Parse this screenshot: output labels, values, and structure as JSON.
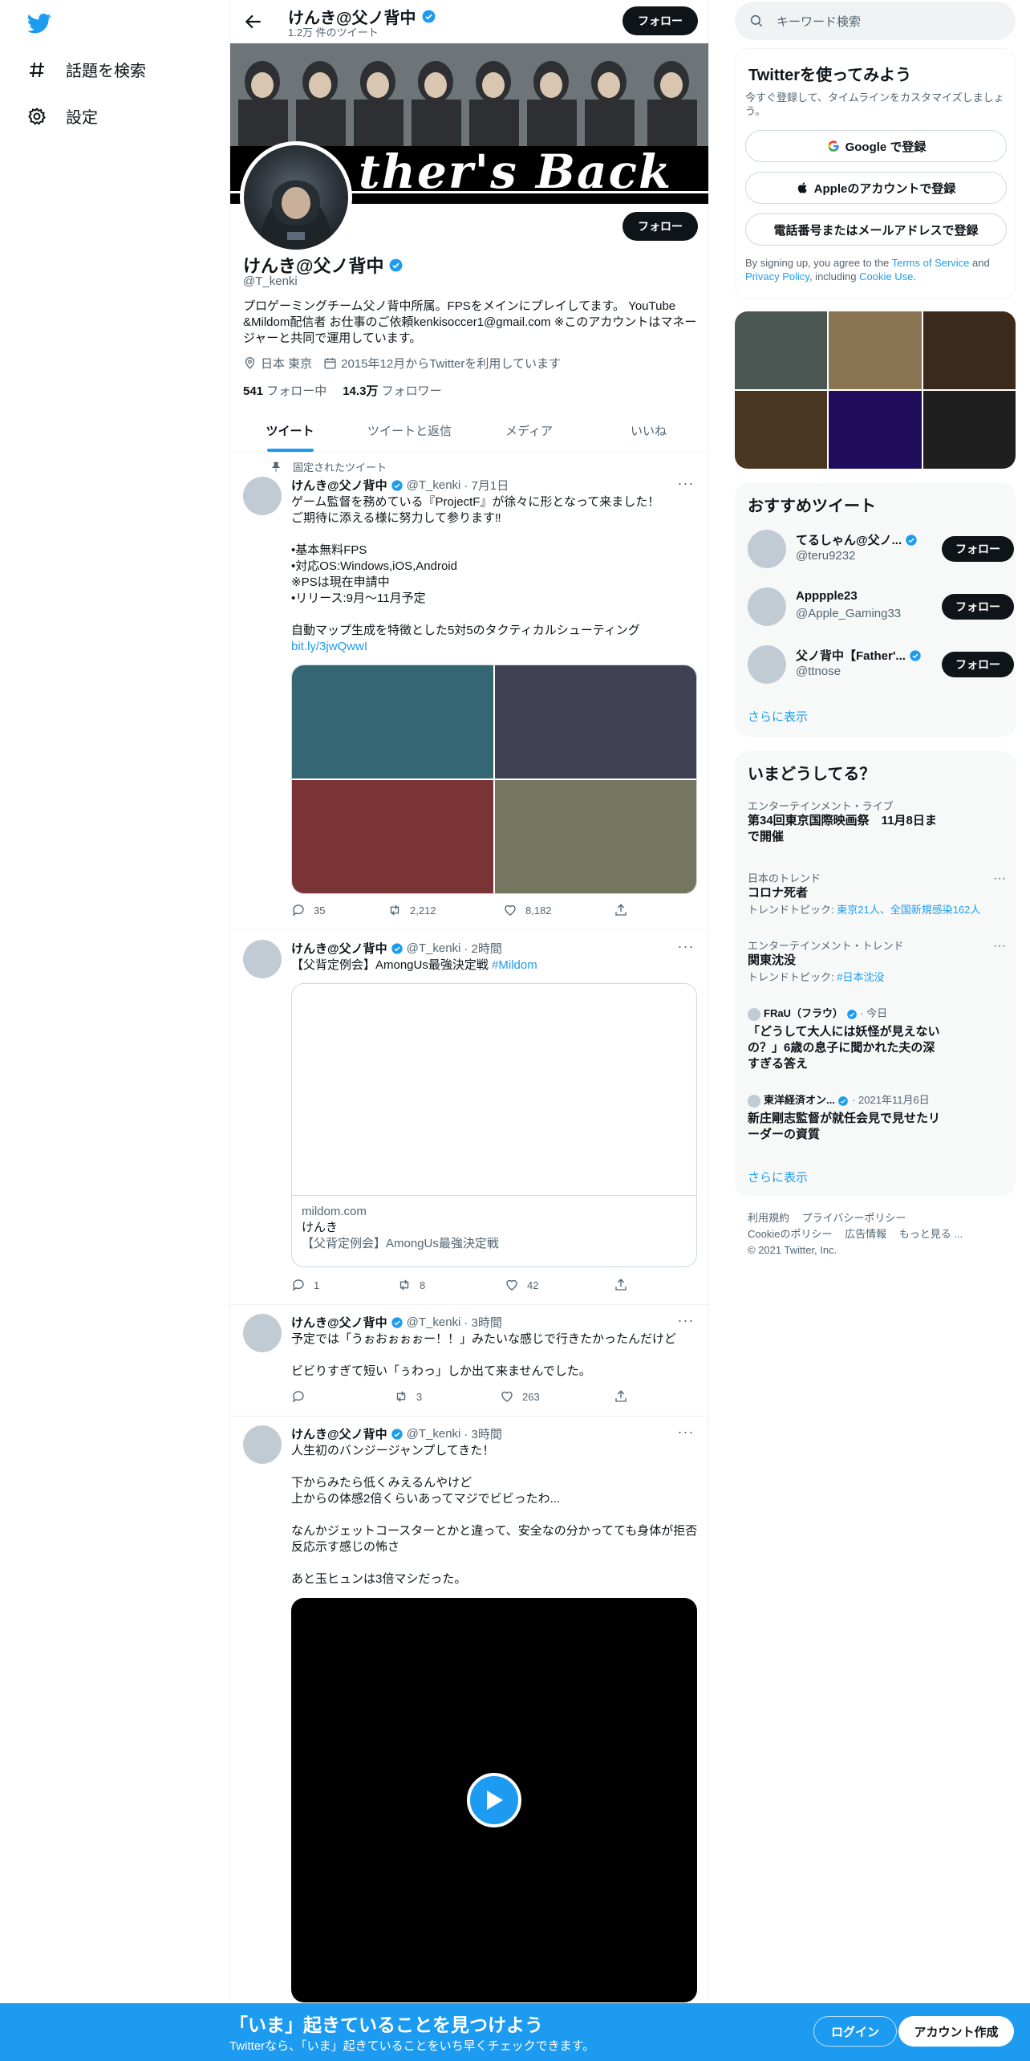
{
  "nav": {
    "explore_label": "話題を検索",
    "settings_label": "設定"
  },
  "header": {
    "name": "けんき@父ノ背中",
    "tweet_count": "1.2万 件のツイート",
    "follow_label": "フォロー"
  },
  "banner": {
    "text": "ther's Back"
  },
  "profile": {
    "name": "けんき@父ノ背中",
    "handle": "@T_kenki",
    "bio": "プロゲーミングチーム父ノ背中所属。FPSをメインにプレイしてます。 YouTube &Mildom配信者 お仕事のご依頼kenkisoccer1@gmail.com ※このアカウントはマネージャーと共同で運用しています。",
    "location": "日本 東京",
    "joined": "2015年12月からTwitterを利用しています",
    "following_count": "541",
    "following_label": "フォロー中",
    "followers_count": "14.3万",
    "followers_label": "フォロワー",
    "follow_label": "フォロー"
  },
  "tabs": [
    "ツイート",
    "ツイートと返信",
    "メディア",
    "いいね"
  ],
  "pinned_label": "固定されたツイート",
  "tweets": [
    {
      "name": "けんき@父ノ背中",
      "handle": "@T_kenki",
      "time": "· 7月1日",
      "text": "ゲーム監督を務めている『ProjectF』が徐々に形となって来ました！\nご期待に添える様に努力して参ります‼︎\n\n•基本無料FPS\n•対応OS:Windows,iOS,Android\n※PSは現在申請中\n•リリース:9月〜11月予定\n\n自動マップ生成を特徴とした5対5のタクティカルシューティング",
      "link": "bit.ly/3jwQwwI",
      "media_colors": [
        "#356674",
        "#3f4152",
        "#7b3436",
        "#74765f"
      ],
      "replies": "35",
      "retweets": "2,212",
      "likes": "8,182"
    },
    {
      "name": "けんき@父ノ背中",
      "handle": "@T_kenki",
      "time": "· 2時間",
      "text": "【父背定例会】AmongUs最強決定戦 ",
      "hashtag": "#Mildom",
      "card_domain": "mildom.com",
      "card_title": "けんき",
      "card_desc": "【父背定例会】AmongUs最強決定戦",
      "replies": "1",
      "retweets": "8",
      "likes": "42"
    },
    {
      "name": "けんき@父ノ背中",
      "handle": "@T_kenki",
      "time": "· 3時間",
      "text": "予定では「うぉおぉぉぉー！！」みたいな感じで行きたかったんだけど\n\nビビりすぎて短い「ぅわっ」しか出て来ませんでした。",
      "replies": "",
      "retweets": "3",
      "likes": "263"
    },
    {
      "name": "けんき@父ノ背中",
      "handle": "@T_kenki",
      "time": "· 3時間",
      "text": "人生初のバンジージャンプしてきた！\n\n下からみたら低くみえるんやけど\n上からの体感2倍くらいあってマジでビビったわ...\n\nなんかジェットコースターとかと違って、安全なの分かってても身体が拒否反応示す感じの怖さ\n\nあと玉ヒュンは3倍マシだった。"
    }
  ],
  "search": {
    "placeholder": "キーワード検索"
  },
  "signup_panel": {
    "title": "Twitterを使ってみよう",
    "subtitle": "今すぐ登録して、タイムラインをカスタマイズしましょう。",
    "google_label": "Google で登録",
    "apple_label": "Appleのアカウントで登録",
    "phone_label": "電話番号またはメールアドレスで登録",
    "legal_prefix": "By signing up, you agree to the ",
    "terms": "Terms of Service",
    "and": " and ",
    "privacy": "Privacy Policy",
    "including": ", including ",
    "cookie": "Cookie Use",
    "period": "."
  },
  "photo_grid_colors": [
    "#4a5651",
    "#8a7553",
    "#3b2a1c",
    "#4a3722",
    "#1f0d5c",
    "#1f1f1f"
  ],
  "recommended": {
    "title": "おすすめツイート",
    "users": [
      {
        "name": "てるしゃん@父ノ...",
        "handle": "@teru9232",
        "follow": "フォロー"
      },
      {
        "name": "Apppple23",
        "handle": "@Apple_Gaming33",
        "follow": "フォロー"
      },
      {
        "name": "父ノ背中【Father'...",
        "handle": "@ttnose",
        "follow": "フォロー"
      }
    ],
    "show_more": "さらに表示"
  },
  "trends": {
    "title": "いまどうしてる？",
    "items": [
      {
        "category": "エンターテインメント・ライブ",
        "title": "第34回東京国際映画祭　11月8日まで開催"
      },
      {
        "category": "日本のトレンド",
        "title": "コロナ死者",
        "sub_label": "トレンドトピック: ",
        "sub_link": "東京21人、全国新規感染162人"
      },
      {
        "category": "エンターテインメント・トレンド",
        "title": "関東沈没",
        "sub_label": "トレンドトピック: ",
        "sub_link": "#日本沈没"
      },
      {
        "source": "FRaU（フラウ）",
        "time": "· 今日",
        "title": "「どうして大人には妖怪が見えないの？」6歳の息子に聞かれた夫の深すぎる答え"
      },
      {
        "source": "東洋経済オン...",
        "time": "· 2021年11月6日",
        "title": "新庄剛志監督が就任会見で見せたリーダーの資質"
      }
    ],
    "show_more": "さらに表示"
  },
  "footer": {
    "terms": "利用規約",
    "privacy": "プライバシーポリシー",
    "cookie": "Cookieのポリシー",
    "ads": "広告情報",
    "more": "もっと見る ...",
    "copyright": "© 2021 Twitter, Inc."
  },
  "bottom_bar": {
    "title": "「いま」起きていることを見つけよう",
    "subtitle": "Twitterなら、「いま」起きていることをいち早くチェックできます。",
    "login": "ログイン",
    "signup": "アカウント作成"
  },
  "colors": {
    "accent": "#1d9bf0",
    "text": "#0f1419",
    "muted": "#536471"
  }
}
